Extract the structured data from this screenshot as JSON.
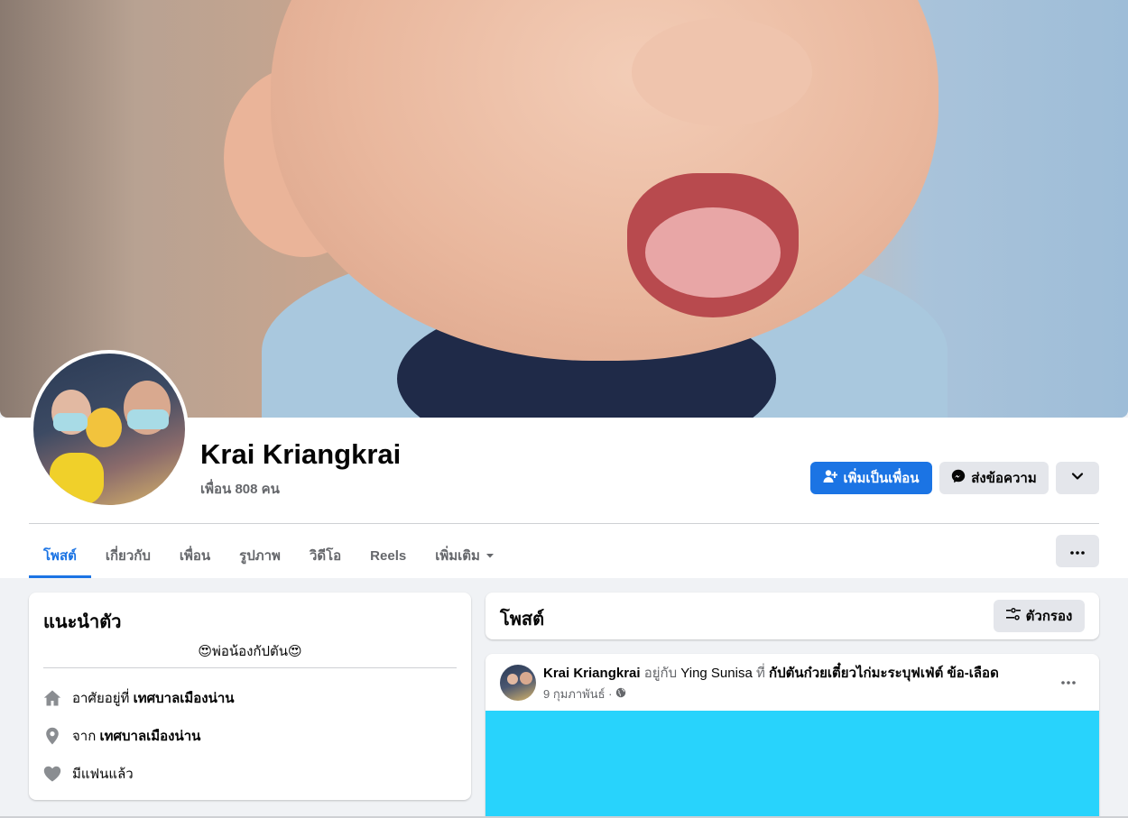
{
  "profile": {
    "name": "Krai Kriangkrai",
    "friends": "เพื่อน 808 คน"
  },
  "actions": {
    "add_friend": "เพิ่มเป็นเพื่อน",
    "message": "ส่งข้อความ"
  },
  "tabs": [
    {
      "label": "โพสต์",
      "active": true
    },
    {
      "label": "เกี่ยวกับ"
    },
    {
      "label": "เพื่อน"
    },
    {
      "label": "รูปภาพ"
    },
    {
      "label": "วิดีโอ"
    },
    {
      "label": "Reels"
    },
    {
      "label": "เพิ่มเติม"
    }
  ],
  "intro": {
    "title": "แนะนำตัว",
    "bio_text": "พ่อน้องกัปตัน",
    "bio_emoji": "😍",
    "lives_prefix": "อาศัยอยู่ที่",
    "lives_place": "เทศบาลเมืองน่าน",
    "from_prefix": "จาก",
    "from_place": "เทศบาลเมืองน่าน",
    "relationship": "มีแฟนแล้ว"
  },
  "posts": {
    "title": "โพสต์",
    "filter_label": "ตัวกรอง"
  },
  "post": {
    "author": "Krai Kriangkrai",
    "with_word": "อยู่กับ",
    "tagged": "Ying Sunisa",
    "at_word": "ที่",
    "place": "กัปตันก๋วยเตี๋ยวไก่มะระบุฟเฟ่ต์ ข้อ-เลือด",
    "date": "9 กุมภาพันธ์ ·",
    "media_color": "#28d3fc"
  },
  "colors": {
    "accent": "#1b74e4",
    "secondary_text": "#65676b"
  }
}
